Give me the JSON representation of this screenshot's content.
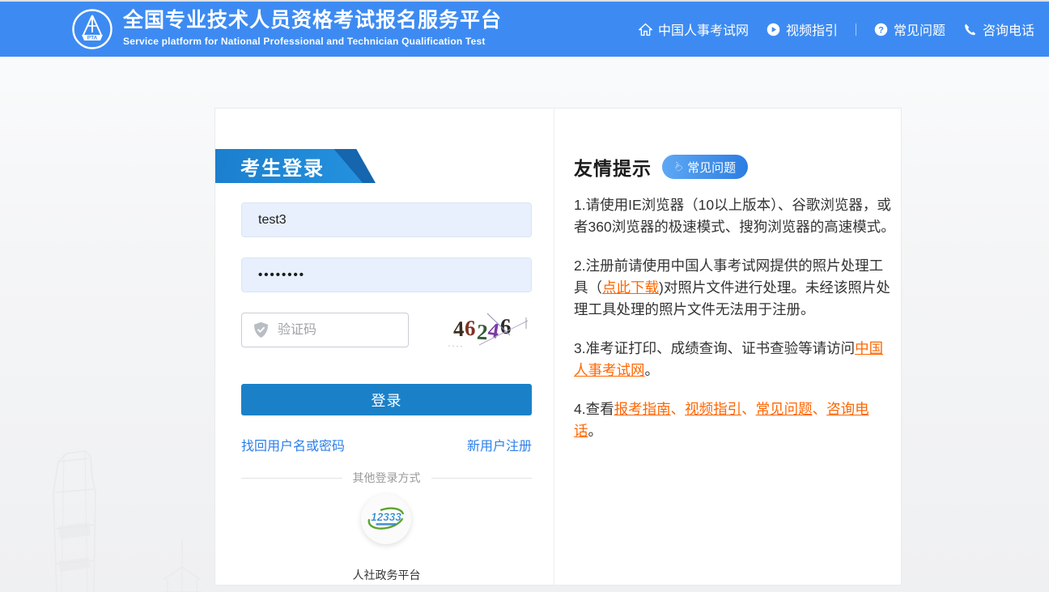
{
  "colors": {
    "header": "#3d8bf2",
    "banner": "#1b7fce",
    "banner_dark": "#1566ae",
    "button": "#1a81c9",
    "link": "#2e80ea",
    "orange": "#ff6600",
    "field_fill": "#e8f0fe",
    "badge_start": "#5ea8f4",
    "badge_end": "#2c7de2"
  },
  "header": {
    "title": "全国专业技术人员资格考试报名服务平台",
    "subtitle": "Service platform for National Professional and Technician Qualification Test",
    "logo_text": "PTA",
    "nav": [
      {
        "icon": "home-icon",
        "label": "中国人事考试网"
      },
      {
        "icon": "play-circle-icon",
        "label": "视频指引"
      },
      {
        "icon": "question-circle-icon",
        "label": "常见问题"
      },
      {
        "icon": "phone-icon",
        "label": "咨询电话"
      }
    ]
  },
  "login": {
    "banner": "考生登录",
    "username": {
      "value": "test3"
    },
    "password": {
      "masked_value": "••••••••"
    },
    "captcha": {
      "placeholder": "验证码",
      "code": "46246",
      "digits": [
        {
          "char": "4",
          "color": "#3b2c20"
        },
        {
          "char": "6",
          "color": "#7d3424"
        },
        {
          "char": "2",
          "color": "#2f5d38"
        },
        {
          "char": "4",
          "color": "#7b3aa6"
        },
        {
          "char": "6",
          "color": "#2b2b2b"
        }
      ]
    },
    "login_button": "登录",
    "forgot_link": "找回用户名或密码",
    "register_link": "新用户注册",
    "other_methods_label": "其他登录方式",
    "sso": {
      "logo_text": "12333",
      "label": "人社政务平台"
    }
  },
  "tips": {
    "heading": "友情提示",
    "faq_badge": "常见问题",
    "items": [
      {
        "segments": [
          {
            "t": "text",
            "v": "1.请使用IE浏览器（10以上版本）、谷歌浏览器，或者360浏览器的极速模式、搜狗浏览器的高速模式。"
          }
        ]
      },
      {
        "segments": [
          {
            "t": "text",
            "v": "2.注册前请使用中国人事考试网提供的照片处理工具（"
          },
          {
            "t": "link",
            "v": "点此下载"
          },
          {
            "t": "text",
            "v": ")对照片文件进行处理。未经该照片处理工具处理的照片文件无法用于注册。"
          }
        ]
      },
      {
        "segments": [
          {
            "t": "text",
            "v": "3.准考证打印、成绩查询、证书查验等请访问"
          },
          {
            "t": "link",
            "v": "中国人事考试网"
          },
          {
            "t": "text",
            "v": "。"
          }
        ]
      },
      {
        "segments": [
          {
            "t": "text",
            "v": "4.查看"
          },
          {
            "t": "link",
            "v": "报考指南"
          },
          {
            "t": "sep",
            "v": "、"
          },
          {
            "t": "link",
            "v": "视频指引"
          },
          {
            "t": "sep",
            "v": "、"
          },
          {
            "t": "link",
            "v": "常见问题"
          },
          {
            "t": "sep",
            "v": "、"
          },
          {
            "t": "link",
            "v": "咨询电话"
          },
          {
            "t": "text",
            "v": "。"
          }
        ]
      }
    ]
  }
}
